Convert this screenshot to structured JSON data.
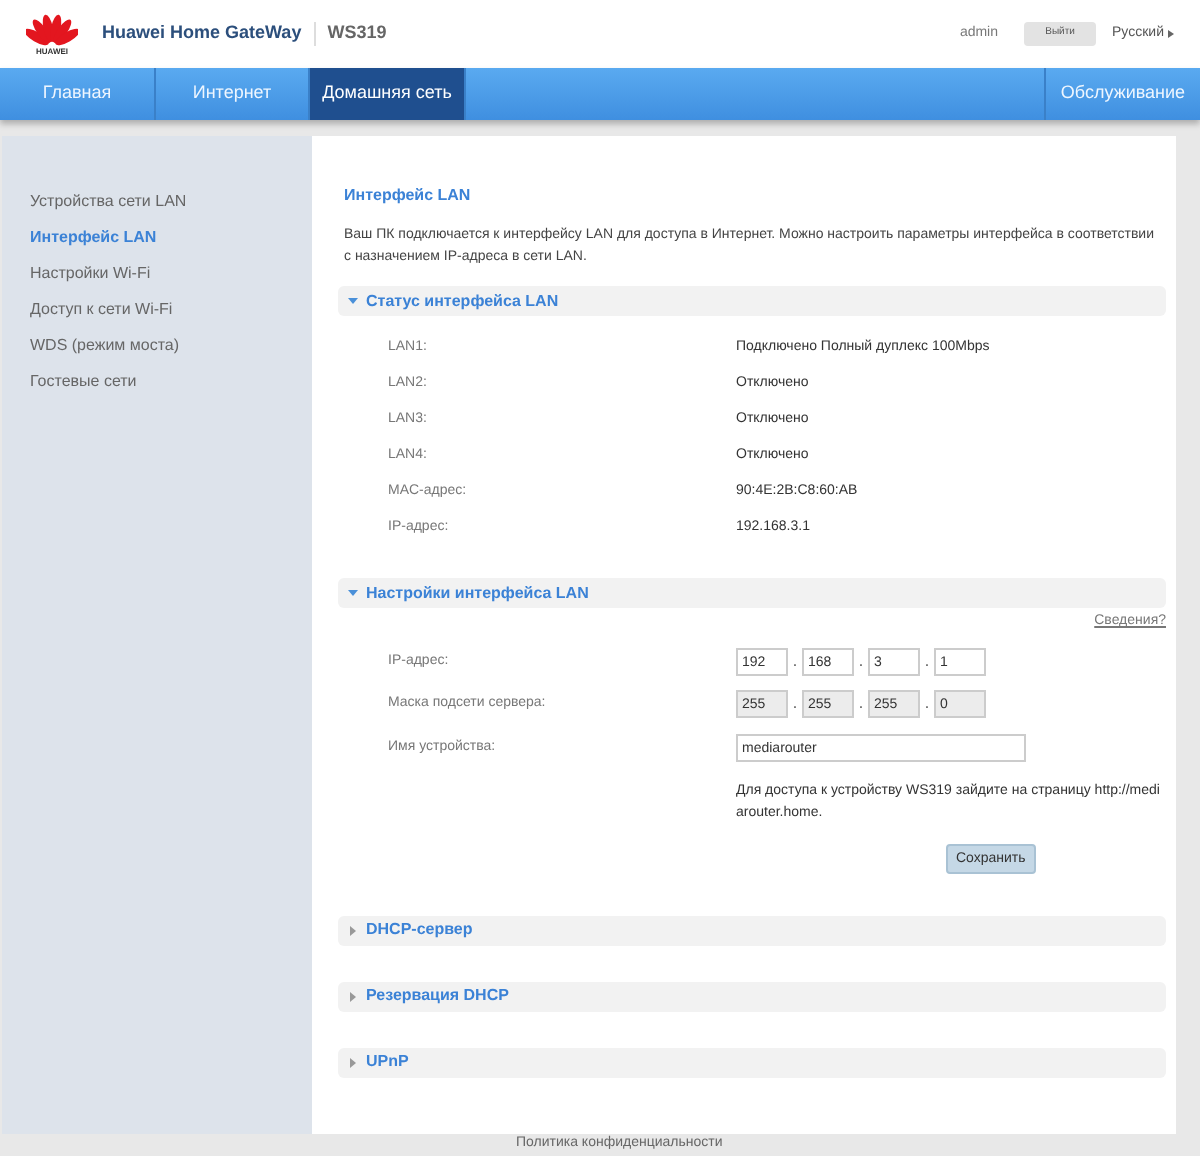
{
  "header": {
    "logo_text": "HUAWEI",
    "brand": "Huawei Home GateWay",
    "model": "WS319",
    "user": "admin",
    "logout": "Выйти",
    "language": "Русский"
  },
  "nav": [
    {
      "label": "Главная",
      "selected": false
    },
    {
      "label": "Интернет",
      "selected": false
    },
    {
      "label": "Домашняя сеть",
      "selected": true
    },
    {
      "label": "Обслуживание",
      "selected": false
    }
  ],
  "sidebar": {
    "items": [
      {
        "label": "Устройства сети LAN",
        "selected": false
      },
      {
        "label": "Интерфейс LAN",
        "selected": true
      },
      {
        "label": "Настройки Wi-Fi",
        "selected": false
      },
      {
        "label": "Доступ к сети Wi-Fi",
        "selected": false
      },
      {
        "label": "WDS (режим моста)",
        "selected": false
      },
      {
        "label": "Гостевые сети",
        "selected": false
      }
    ]
  },
  "content": {
    "title": "Интерфейс LAN",
    "description": "Ваш ПК подключается к интерфейсу LAN для доступа в Интернет. Можно настроить параметры интерфейса в соответствии с назначением IP-адреса в сети LAN.",
    "sections": [
      {
        "kind": "status",
        "title": "Статус интерфейса LAN",
        "expanded": true,
        "rows": [
          {
            "label": "LAN1:",
            "value": "Подключено Полный дуплекс 100Mbps"
          },
          {
            "label": "LAN2:",
            "value": "Отключено"
          },
          {
            "label": "LAN3:",
            "value": "Отключено"
          },
          {
            "label": "LAN4:",
            "value": "Отключено"
          },
          {
            "label": "MAC-адрес:",
            "value": "90:4E:2B:C8:60:AB"
          },
          {
            "label": "IP-адрес:",
            "value": "192.168.3.1"
          }
        ]
      },
      {
        "kind": "settings",
        "title": "Настройки интерфейса LAN",
        "expanded": true,
        "help_link": "Сведения?",
        "ip_label": "IP-адрес:",
        "ip": [
          {
            "value": "192",
            "disabled": false
          },
          {
            "value": "168",
            "disabled": false
          },
          {
            "value": "3",
            "disabled": false
          },
          {
            "value": "1",
            "disabled": false
          }
        ],
        "mask_label": "Маска подсети сервера:",
        "mask": [
          {
            "value": "255",
            "disabled": true
          },
          {
            "value": "255",
            "disabled": true
          },
          {
            "value": "255",
            "disabled": true
          },
          {
            "value": "0",
            "disabled": true
          }
        ],
        "separator": ".",
        "name_label": "Имя устройства:",
        "name_value": "mediarouter",
        "note": "Для доступа к устройству WS319 зайдите на страницу http://mediarouter.home.",
        "save": "Сохранить"
      },
      {
        "kind": "collapsed",
        "title": "DHCP-сервер",
        "expanded": false
      },
      {
        "kind": "collapsed",
        "title": "Резервация DHCP",
        "expanded": false
      },
      {
        "kind": "collapsed",
        "title": "UPnP",
        "expanded": false
      }
    ]
  },
  "footer": {
    "link": "Политика конфиденциальности"
  }
}
